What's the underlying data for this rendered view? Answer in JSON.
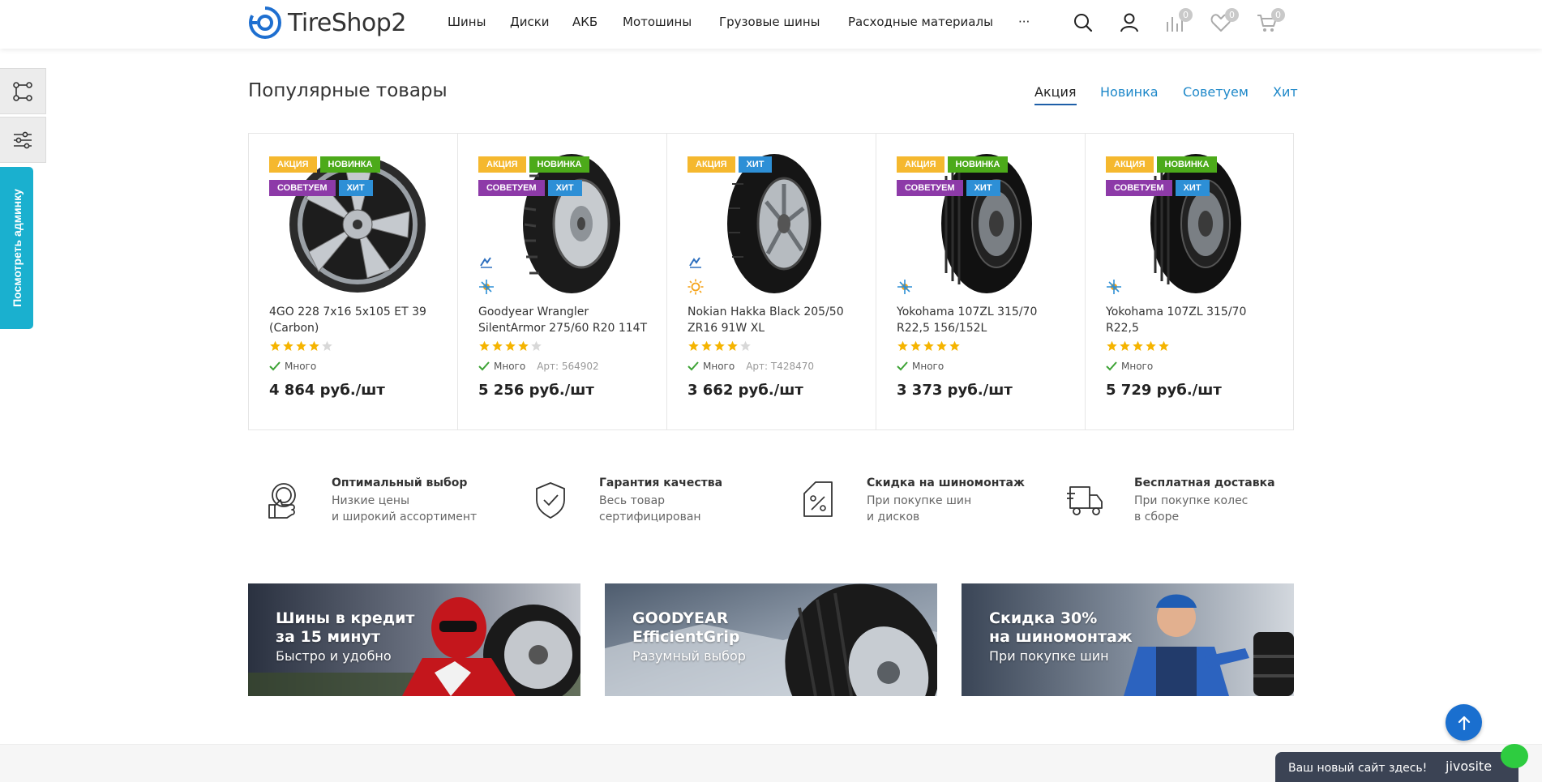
{
  "header": {
    "logo_text": "TireShop2",
    "nav": [
      {
        "label": "Шины"
      },
      {
        "label": "Диски"
      },
      {
        "label": "АКБ"
      },
      {
        "label": "Мотошины"
      },
      {
        "label": "Грузовые шины"
      },
      {
        "label": "Расходные материалы"
      },
      {
        "label": "···"
      }
    ],
    "compare_count": "0",
    "wishlist_count": "0",
    "cart_count": "0"
  },
  "side": {
    "admin_label": "Посмотреть админку"
  },
  "popular": {
    "title": "Популярные товары",
    "tabs": [
      {
        "label": "Акция"
      },
      {
        "label": "Новинка"
      },
      {
        "label": "Советуем"
      },
      {
        "label": "Хит"
      }
    ],
    "active_tab": "Акция",
    "products": [
      {
        "name": "4GO 228 7x16 5x105 ET 39 (Carbon)",
        "labels": [
          "АКЦИЯ",
          "НОВИНКА",
          "СОВЕТУЕМ",
          "ХИТ"
        ],
        "rating": 4,
        "stock": "Много",
        "art": "",
        "price": "4 864 руб./шт",
        "season": ""
      },
      {
        "name": "Goodyear Wrangler SilentArmor 275/60 R20 114T",
        "labels": [
          "АКЦИЯ",
          "НОВИНКА",
          "СОВЕТУЕМ",
          "ХИТ"
        ],
        "rating": 4,
        "stock": "Много",
        "art": "Арт: 564902",
        "price": "5 256 руб./шт",
        "season": "all-season"
      },
      {
        "name": "Nokian Hakka Black 205/50 ZR16 91W XL",
        "labels": [
          "АКЦИЯ",
          "ХИТ"
        ],
        "rating": 4,
        "stock": "Много",
        "art": "Арт: T428470",
        "price": "3 662 руб./шт",
        "season": "summer"
      },
      {
        "name": "Yokohama 107ZL 315/70 R22,5 156/152L",
        "labels": [
          "АКЦИЯ",
          "НОВИНКА",
          "СОВЕТУЕМ",
          "ХИТ"
        ],
        "rating": 5,
        "stock": "Много",
        "art": "",
        "price": "3 373 руб./шт",
        "season": "all-weather"
      },
      {
        "name": "Yokohama 107ZL 315/70 R22,5",
        "labels": [
          "АКЦИЯ",
          "НОВИНКА",
          "СОВЕТУЕМ",
          "ХИТ"
        ],
        "rating": 5,
        "stock": "Много",
        "art": "",
        "price": "5 729 руб./шт",
        "season": "all-weather"
      }
    ]
  },
  "advantages": [
    {
      "title": "Оптимальный выбор",
      "line1": "Низкие цены",
      "line2": "и широкий ассортимент",
      "icon": "thumb-up-icon"
    },
    {
      "title": "Гарантия качества",
      "line1": "Весь товар",
      "line2": "сертифицирован",
      "icon": "shield-check-icon"
    },
    {
      "title": "Скидка на шиномонтаж",
      "line1": "При покупке шин",
      "line2": "и дисков",
      "icon": "discount-tag-icon"
    },
    {
      "title": "Бесплатная доставка",
      "line1": "При покупке колес",
      "line2": "в сборе",
      "icon": "truck-icon"
    }
  ],
  "banners": [
    {
      "title": "Шины в кредит\nза 15 минут",
      "subtitle": "Быстро и удобно"
    },
    {
      "title": "GOODYEAR\nEfficientGrip",
      "subtitle": "Разумный выбор"
    },
    {
      "title": "Скидка 30%\nна шиномонтаж",
      "subtitle": "При покупке шин"
    }
  ],
  "jivo": {
    "text": "Ваш новый сайт здесь!",
    "brand": "jivosite"
  },
  "colors": {
    "label_sale": "#f5b82e",
    "label_new": "#4caa1a",
    "label_recommend": "#8d3aa8",
    "label_hit": "#2d8fd6",
    "star": "#f5b400",
    "link": "#1e88c9",
    "admin_tab": "#1ab0cf"
  }
}
